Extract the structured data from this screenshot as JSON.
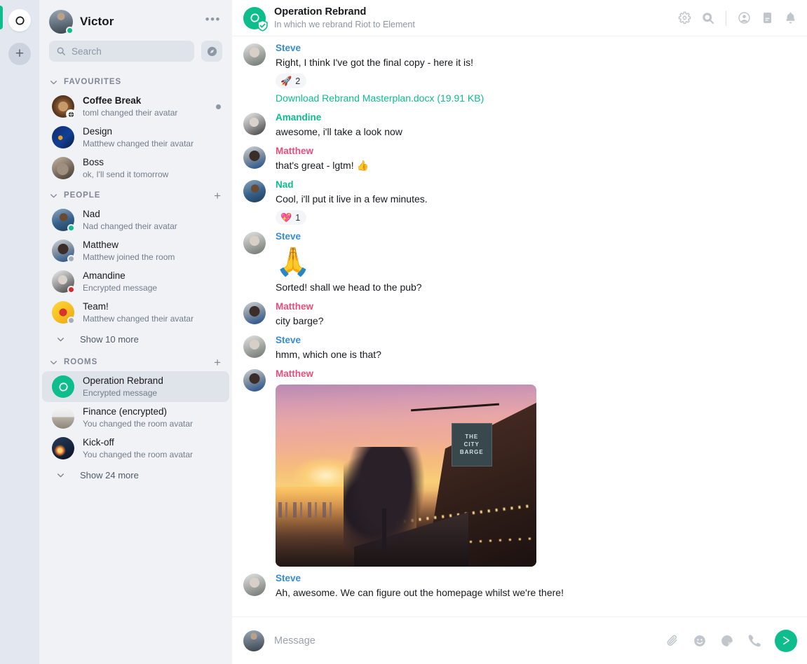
{
  "colors": {
    "accent": "#0dbd8b",
    "space_bar_bg": "#e3e8f0",
    "left_panel_bg": "#f0f2f6",
    "selected_room_bg": "#dfe3ea",
    "sender_green": "#0dbd8b",
    "sender_blue": "#368bd6",
    "sender_pink": "#e64f7a",
    "muted_text": "#8d97a5"
  },
  "space_bar": {
    "home_icon": "element-logo-icon",
    "add_space_label": "+",
    "active_space": "home"
  },
  "left_panel": {
    "user": {
      "name": "Victor",
      "presence": "online",
      "avatar": "av-victor"
    },
    "options_label": "•••",
    "search": {
      "placeholder": "Search",
      "icon": "search-icon"
    },
    "explore_button": {
      "icon": "explore-compass-icon",
      "label": "Explore rooms"
    },
    "sections": [
      {
        "title": "FAVOURITES",
        "has_add": false,
        "rooms": [
          {
            "name": "Coffee Break",
            "subtitle": "toml changed their avatar",
            "avatar": "av-coffee",
            "badge": "globe-icon",
            "unread": true,
            "unread_dot": true,
            "selected": false
          },
          {
            "name": "Design",
            "subtitle": "Matthew changed their avatar",
            "avatar": "av-design",
            "badge": null,
            "unread": false,
            "unread_dot": false,
            "selected": false
          },
          {
            "name": "Boss",
            "subtitle": "ok, I'll send it tomorrow",
            "avatar": "av-boss",
            "badge": null,
            "unread": false,
            "unread_dot": false,
            "selected": false
          }
        ],
        "show_more": null
      },
      {
        "title": "PEOPLE",
        "has_add": true,
        "add_label": "+",
        "rooms": [
          {
            "name": "Nad",
            "subtitle": "Nad changed their avatar",
            "avatar": "av-nad",
            "presence": "online",
            "selected": false
          },
          {
            "name": "Matthew",
            "subtitle": "Matthew joined the room",
            "avatar": "av-matthew",
            "presence": "away",
            "selected": false
          },
          {
            "name": "Amandine",
            "subtitle": "Encrypted message",
            "avatar": "av-amandine",
            "presence": "dnd",
            "selected": false
          },
          {
            "name": "Team!",
            "subtitle": "Matthew changed their avatar",
            "avatar": "av-team",
            "presence": "away",
            "selected": false
          }
        ],
        "show_more": "Show 10 more"
      },
      {
        "title": "ROOMS",
        "has_add": true,
        "add_label": "+",
        "rooms": [
          {
            "name": "Operation Rebrand",
            "subtitle": "Encrypted message",
            "avatar": "av-elem-room",
            "selected": true
          },
          {
            "name": "Finance (encrypted)",
            "subtitle": "You changed the room avatar",
            "avatar": "av-finance",
            "selected": false
          },
          {
            "name": "Kick-off",
            "subtitle": "You changed the room avatar",
            "avatar": "av-kickoff",
            "selected": false
          }
        ],
        "show_more": "Show 24 more"
      }
    ]
  },
  "room_header": {
    "title": "Operation Rebrand",
    "topic": "In which we rebrand Riot to Element",
    "avatar": "av-elem-room",
    "verified_badge": "shield-verified-icon",
    "icons": [
      {
        "name": "room-settings-icon",
        "label": "Room settings"
      },
      {
        "name": "room-search-icon",
        "label": "Search"
      },
      {
        "name": "room-members-icon",
        "label": "Room info / members"
      },
      {
        "name": "room-files-icon",
        "label": "Files"
      },
      {
        "name": "room-notifications-icon",
        "label": "Notifications"
      }
    ]
  },
  "timeline": {
    "events": [
      {
        "sender": "Steve",
        "sender_color": "#368bd6",
        "avatar": "av-steve",
        "lines": [
          "Right, I think I've got the final copy - here it is!"
        ],
        "reactions": [
          {
            "emoji": "🚀",
            "count": "2"
          }
        ],
        "file": "Download Rebrand Masterplan.docx (19.91 KB)"
      },
      {
        "sender": "Amandine",
        "sender_color": "#0dbd8b",
        "avatar": "av-amandine",
        "lines": [
          "awesome, i'll take a look now"
        ],
        "reactions": [],
        "file": null
      },
      {
        "sender": "Matthew",
        "sender_color": "#e64f7a",
        "avatar": "av-matthew",
        "lines": [
          "that's great - lgtm! 👍"
        ],
        "reactions": [],
        "file": null
      },
      {
        "sender": "Nad",
        "sender_color": "#0dbd8b",
        "avatar": "av-nad",
        "lines": [
          "Cool, i'll put it live in a few minutes."
        ],
        "reactions": [
          {
            "emoji": "💖",
            "count": "1"
          }
        ],
        "file": null
      },
      {
        "sender": "Steve",
        "sender_color": "#368bd6",
        "avatar": "av-steve",
        "big_emoji": "🙏",
        "lines": [
          "Sorted! shall we head to the pub?"
        ],
        "reactions": [],
        "file": null
      },
      {
        "sender": "Matthew",
        "sender_color": "#e64f7a",
        "avatar": "av-matthew",
        "lines": [
          "city barge?"
        ],
        "reactions": [],
        "file": null
      },
      {
        "sender": "Steve",
        "sender_color": "#368bd6",
        "avatar": "av-steve",
        "lines": [
          "hmm, which one is that?"
        ],
        "reactions": [],
        "file": null
      },
      {
        "sender": "Matthew",
        "sender_color": "#e64f7a",
        "avatar": "av-matthew",
        "lines": [],
        "image": {
          "alt": "Sunset photo of The City Barge riverside pub",
          "sign_line1": "THE",
          "sign_line2": "CITY",
          "sign_line3": "BARGE"
        },
        "reactions": [],
        "file": null
      },
      {
        "sender": "Steve",
        "sender_color": "#368bd6",
        "avatar": "av-steve",
        "lines": [
          "Ah, awesome. We can figure out the homepage whilst we're there!"
        ],
        "reactions": [],
        "file": null
      }
    ]
  },
  "composer": {
    "avatar": "av-victor",
    "placeholder": "Message",
    "icons": [
      {
        "name": "attachment-icon",
        "label": "Attachment"
      },
      {
        "name": "emoji-icon",
        "label": "Emoji"
      },
      {
        "name": "sticker-icon",
        "label": "Sticker"
      },
      {
        "name": "voice-call-icon",
        "label": "Voice call"
      }
    ],
    "send_button": {
      "name": "send-icon",
      "label": "Send"
    }
  }
}
